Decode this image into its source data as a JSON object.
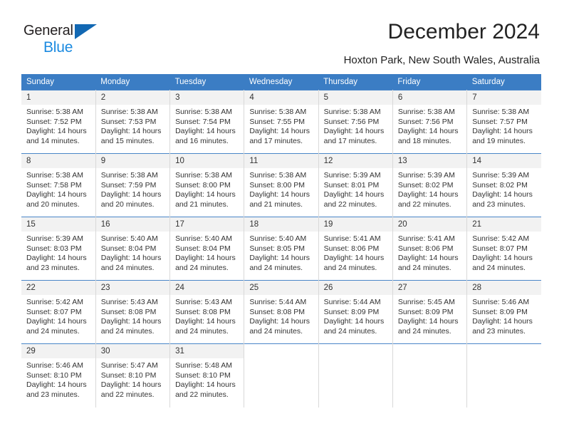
{
  "brand": {
    "name_top": "General",
    "name_bottom": "Blue",
    "triangle_color": "#1268b3",
    "blue_color": "#1b8ae0"
  },
  "header": {
    "title": "December 2024",
    "subtitle": "Hoxton Park, New South Wales, Australia",
    "header_bg": "#3b7dc4",
    "row_border": "#4a86c8",
    "daynum_bg": "#f2f2f2"
  },
  "weekdays": [
    "Sunday",
    "Monday",
    "Tuesday",
    "Wednesday",
    "Thursday",
    "Friday",
    "Saturday"
  ],
  "labels": {
    "sunrise": "Sunrise:",
    "sunset": "Sunset:",
    "daylight": "Daylight:"
  },
  "weeks": [
    [
      {
        "day": "1",
        "sunrise": "Sunrise: 5:38 AM",
        "sunset": "Sunset: 7:52 PM",
        "daylight1": "Daylight: 14 hours",
        "daylight2": "and 14 minutes."
      },
      {
        "day": "2",
        "sunrise": "Sunrise: 5:38 AM",
        "sunset": "Sunset: 7:53 PM",
        "daylight1": "Daylight: 14 hours",
        "daylight2": "and 15 minutes."
      },
      {
        "day": "3",
        "sunrise": "Sunrise: 5:38 AM",
        "sunset": "Sunset: 7:54 PM",
        "daylight1": "Daylight: 14 hours",
        "daylight2": "and 16 minutes."
      },
      {
        "day": "4",
        "sunrise": "Sunrise: 5:38 AM",
        "sunset": "Sunset: 7:55 PM",
        "daylight1": "Daylight: 14 hours",
        "daylight2": "and 17 minutes."
      },
      {
        "day": "5",
        "sunrise": "Sunrise: 5:38 AM",
        "sunset": "Sunset: 7:56 PM",
        "daylight1": "Daylight: 14 hours",
        "daylight2": "and 17 minutes."
      },
      {
        "day": "6",
        "sunrise": "Sunrise: 5:38 AM",
        "sunset": "Sunset: 7:56 PM",
        "daylight1": "Daylight: 14 hours",
        "daylight2": "and 18 minutes."
      },
      {
        "day": "7",
        "sunrise": "Sunrise: 5:38 AM",
        "sunset": "Sunset: 7:57 PM",
        "daylight1": "Daylight: 14 hours",
        "daylight2": "and 19 minutes."
      }
    ],
    [
      {
        "day": "8",
        "sunrise": "Sunrise: 5:38 AM",
        "sunset": "Sunset: 7:58 PM",
        "daylight1": "Daylight: 14 hours",
        "daylight2": "and 20 minutes."
      },
      {
        "day": "9",
        "sunrise": "Sunrise: 5:38 AM",
        "sunset": "Sunset: 7:59 PM",
        "daylight1": "Daylight: 14 hours",
        "daylight2": "and 20 minutes."
      },
      {
        "day": "10",
        "sunrise": "Sunrise: 5:38 AM",
        "sunset": "Sunset: 8:00 PM",
        "daylight1": "Daylight: 14 hours",
        "daylight2": "and 21 minutes."
      },
      {
        "day": "11",
        "sunrise": "Sunrise: 5:38 AM",
        "sunset": "Sunset: 8:00 PM",
        "daylight1": "Daylight: 14 hours",
        "daylight2": "and 21 minutes."
      },
      {
        "day": "12",
        "sunrise": "Sunrise: 5:39 AM",
        "sunset": "Sunset: 8:01 PM",
        "daylight1": "Daylight: 14 hours",
        "daylight2": "and 22 minutes."
      },
      {
        "day": "13",
        "sunrise": "Sunrise: 5:39 AM",
        "sunset": "Sunset: 8:02 PM",
        "daylight1": "Daylight: 14 hours",
        "daylight2": "and 22 minutes."
      },
      {
        "day": "14",
        "sunrise": "Sunrise: 5:39 AM",
        "sunset": "Sunset: 8:02 PM",
        "daylight1": "Daylight: 14 hours",
        "daylight2": "and 23 minutes."
      }
    ],
    [
      {
        "day": "15",
        "sunrise": "Sunrise: 5:39 AM",
        "sunset": "Sunset: 8:03 PM",
        "daylight1": "Daylight: 14 hours",
        "daylight2": "and 23 minutes."
      },
      {
        "day": "16",
        "sunrise": "Sunrise: 5:40 AM",
        "sunset": "Sunset: 8:04 PM",
        "daylight1": "Daylight: 14 hours",
        "daylight2": "and 24 minutes."
      },
      {
        "day": "17",
        "sunrise": "Sunrise: 5:40 AM",
        "sunset": "Sunset: 8:04 PM",
        "daylight1": "Daylight: 14 hours",
        "daylight2": "and 24 minutes."
      },
      {
        "day": "18",
        "sunrise": "Sunrise: 5:40 AM",
        "sunset": "Sunset: 8:05 PM",
        "daylight1": "Daylight: 14 hours",
        "daylight2": "and 24 minutes."
      },
      {
        "day": "19",
        "sunrise": "Sunrise: 5:41 AM",
        "sunset": "Sunset: 8:06 PM",
        "daylight1": "Daylight: 14 hours",
        "daylight2": "and 24 minutes."
      },
      {
        "day": "20",
        "sunrise": "Sunrise: 5:41 AM",
        "sunset": "Sunset: 8:06 PM",
        "daylight1": "Daylight: 14 hours",
        "daylight2": "and 24 minutes."
      },
      {
        "day": "21",
        "sunrise": "Sunrise: 5:42 AM",
        "sunset": "Sunset: 8:07 PM",
        "daylight1": "Daylight: 14 hours",
        "daylight2": "and 24 minutes."
      }
    ],
    [
      {
        "day": "22",
        "sunrise": "Sunrise: 5:42 AM",
        "sunset": "Sunset: 8:07 PM",
        "daylight1": "Daylight: 14 hours",
        "daylight2": "and 24 minutes."
      },
      {
        "day": "23",
        "sunrise": "Sunrise: 5:43 AM",
        "sunset": "Sunset: 8:08 PM",
        "daylight1": "Daylight: 14 hours",
        "daylight2": "and 24 minutes."
      },
      {
        "day": "24",
        "sunrise": "Sunrise: 5:43 AM",
        "sunset": "Sunset: 8:08 PM",
        "daylight1": "Daylight: 14 hours",
        "daylight2": "and 24 minutes."
      },
      {
        "day": "25",
        "sunrise": "Sunrise: 5:44 AM",
        "sunset": "Sunset: 8:08 PM",
        "daylight1": "Daylight: 14 hours",
        "daylight2": "and 24 minutes."
      },
      {
        "day": "26",
        "sunrise": "Sunrise: 5:44 AM",
        "sunset": "Sunset: 8:09 PM",
        "daylight1": "Daylight: 14 hours",
        "daylight2": "and 24 minutes."
      },
      {
        "day": "27",
        "sunrise": "Sunrise: 5:45 AM",
        "sunset": "Sunset: 8:09 PM",
        "daylight1": "Daylight: 14 hours",
        "daylight2": "and 24 minutes."
      },
      {
        "day": "28",
        "sunrise": "Sunrise: 5:46 AM",
        "sunset": "Sunset: 8:09 PM",
        "daylight1": "Daylight: 14 hours",
        "daylight2": "and 23 minutes."
      }
    ],
    [
      {
        "day": "29",
        "sunrise": "Sunrise: 5:46 AM",
        "sunset": "Sunset: 8:10 PM",
        "daylight1": "Daylight: 14 hours",
        "daylight2": "and 23 minutes."
      },
      {
        "day": "30",
        "sunrise": "Sunrise: 5:47 AM",
        "sunset": "Sunset: 8:10 PM",
        "daylight1": "Daylight: 14 hours",
        "daylight2": "and 22 minutes."
      },
      {
        "day": "31",
        "sunrise": "Sunrise: 5:48 AM",
        "sunset": "Sunset: 8:10 PM",
        "daylight1": "Daylight: 14 hours",
        "daylight2": "and 22 minutes."
      },
      {
        "day": "",
        "sunrise": "",
        "sunset": "",
        "daylight1": "",
        "daylight2": ""
      },
      {
        "day": "",
        "sunrise": "",
        "sunset": "",
        "daylight1": "",
        "daylight2": ""
      },
      {
        "day": "",
        "sunrise": "",
        "sunset": "",
        "daylight1": "",
        "daylight2": ""
      },
      {
        "day": "",
        "sunrise": "",
        "sunset": "",
        "daylight1": "",
        "daylight2": ""
      }
    ]
  ]
}
